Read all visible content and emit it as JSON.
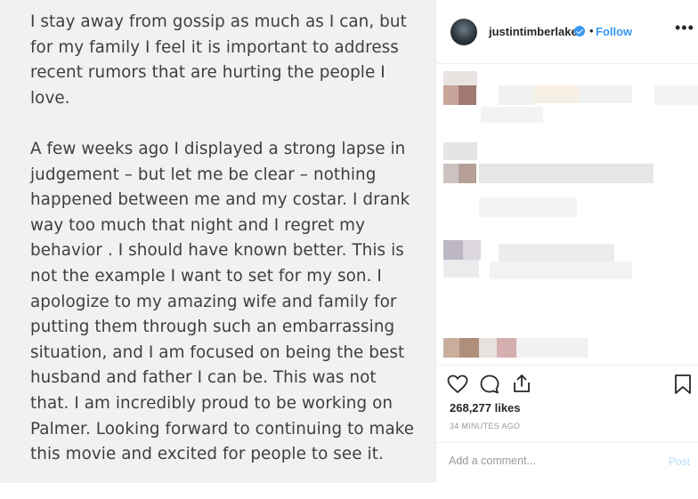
{
  "note": {
    "paragraphs": [
      {
        "lines": [
          "I stay away from gossip as much as I can, but",
          "for my family I feel it is important to address",
          "recent rumors that are hurting the people I",
          "love."
        ]
      },
      {
        "lines": [
          "A few weeks ago I displayed a strong lapse in",
          "judgement – but let me be clear – nothing",
          "happened between me and my costar. I drank",
          "way too much that night and I regret my",
          "behavior . I should have known better. This is",
          "not the example I want to set for my son. I",
          "apologize to my amazing wife and family for",
          "putting them through such an embarrassing",
          "situation, and I am focused on being the best",
          "husband and father I can be. This was not",
          "that. I am incredibly proud to be working on",
          "Palmer. Looking forward to continuing to make",
          "this movie and excited for people to see it."
        ]
      }
    ]
  },
  "header": {
    "username": "justintimberlake",
    "separator": "•",
    "follow_label": "Follow",
    "more_label": "•••",
    "verified_color": "#3897f0"
  },
  "actions": {
    "icons": [
      "heart-icon",
      "comment-icon",
      "share-icon",
      "bookmark-icon"
    ],
    "likes": "268,277 likes",
    "time": "34 MINUTES AGO"
  },
  "comment_box": {
    "placeholder": "Add a comment...",
    "post_label": "Post",
    "post_color": "#b2dffc"
  }
}
